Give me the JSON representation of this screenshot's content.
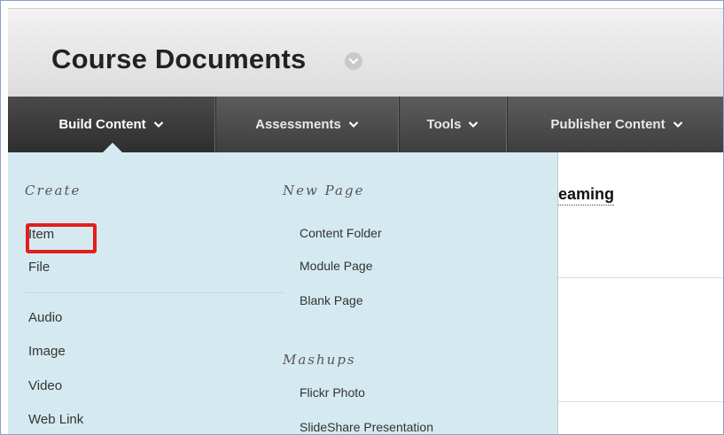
{
  "page": {
    "title": "Course Documents"
  },
  "nav": {
    "items": [
      {
        "label": "Build Content"
      },
      {
        "label": "Assessments"
      },
      {
        "label": "Tools"
      },
      {
        "label": "Publisher Content"
      }
    ]
  },
  "content": {
    "partial_item": "reaming"
  },
  "menu": {
    "create": {
      "heading": "Create",
      "items": [
        "Item",
        "File",
        "Audio",
        "Image",
        "Video",
        "Web Link"
      ]
    },
    "new_page": {
      "heading": "New Page",
      "items": [
        "Content Folder",
        "Module Page",
        "Blank Page"
      ]
    },
    "mashups": {
      "heading": "Mashups",
      "items": [
        "Flickr Photo",
        "SlideShare Presentation"
      ]
    }
  },
  "colors": {
    "nav_bg": "#4a4a4a",
    "dropdown_bg": "#d5eaf0",
    "highlight": "#e41d1d"
  }
}
